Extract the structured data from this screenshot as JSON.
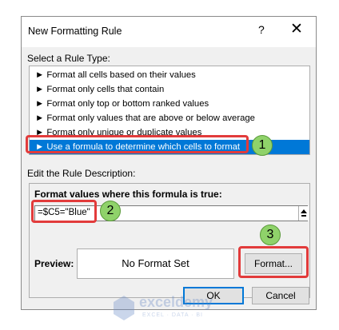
{
  "dialog": {
    "title": "New Formatting Rule",
    "help_label": "?",
    "close_label": "✕"
  },
  "rule_type": {
    "label": "Select a Rule Type:",
    "items": [
      {
        "label": "Format all cells based on their values"
      },
      {
        "label": "Format only cells that contain"
      },
      {
        "label": "Format only top or bottom ranked values"
      },
      {
        "label": "Format only values that are above or below average"
      },
      {
        "label": "Format only unique or duplicate values"
      },
      {
        "label": "Use a formula to determine which cells to format",
        "selected": true
      }
    ],
    "bullet": "►"
  },
  "rule_description": {
    "label": "Edit the Rule Description:",
    "formula_label": "Format values where this formula is true:",
    "formula_value": "=$C5=\"Blue\"",
    "preview_label": "Preview:",
    "preview_text": "No Format Set",
    "format_button": "Format..."
  },
  "buttons": {
    "ok": "OK",
    "cancel": "Cancel"
  },
  "annotations": {
    "step1": "1",
    "step2": "2",
    "step3": "3",
    "highlight_color": "#e23b3b",
    "badge_color": "#8fd26a"
  },
  "watermark": {
    "brand": "exceldemy",
    "tagline": "EXCEL · DATA · BI"
  },
  "colors": {
    "selection": "#0078d7",
    "dialog_bg": "#f0f0f0"
  }
}
